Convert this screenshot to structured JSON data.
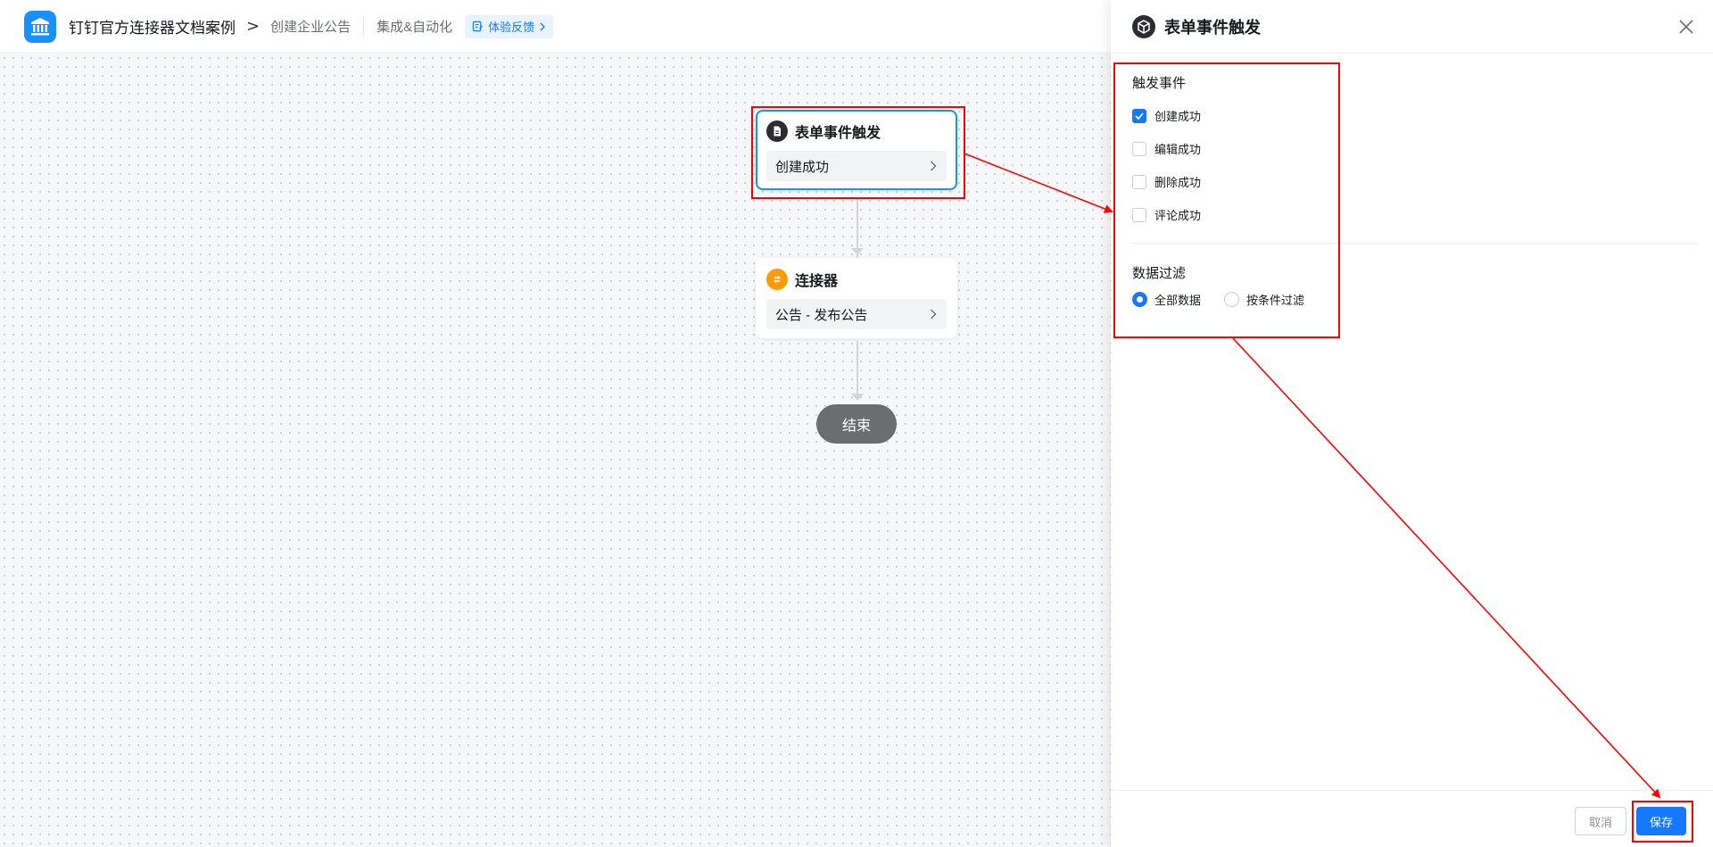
{
  "header": {
    "app_name": "钉钉官方连接器文档案例",
    "breadcrumb_separator": ">",
    "page_name": "创建企业公告",
    "module_name": "集成&自动化",
    "feedback_label": "体验反馈"
  },
  "flow": {
    "trigger_node": {
      "title": "表单事件触发",
      "value": "创建成功"
    },
    "connector_node": {
      "title": "连接器",
      "value": "公告 - 发布公告"
    },
    "end_node": {
      "label": "结束"
    }
  },
  "drawer": {
    "title": "表单事件触发",
    "trigger_events": {
      "title": "触发事件",
      "options": [
        {
          "label": "创建成功",
          "checked": true
        },
        {
          "label": "编辑成功",
          "checked": false
        },
        {
          "label": "删除成功",
          "checked": false
        },
        {
          "label": "评论成功",
          "checked": false
        }
      ]
    },
    "data_filter": {
      "title": "数据过滤",
      "options": [
        {
          "label": "全部数据",
          "selected": true
        },
        {
          "label": "按条件过滤",
          "selected": false
        }
      ]
    },
    "footer": {
      "cancel_label": "取消",
      "save_label": "保存"
    }
  },
  "colors": {
    "primary": "#1677ff",
    "annotation": "#ff0000",
    "connector_icon": "#ff9a0a",
    "end_node": "#6b6d70"
  }
}
